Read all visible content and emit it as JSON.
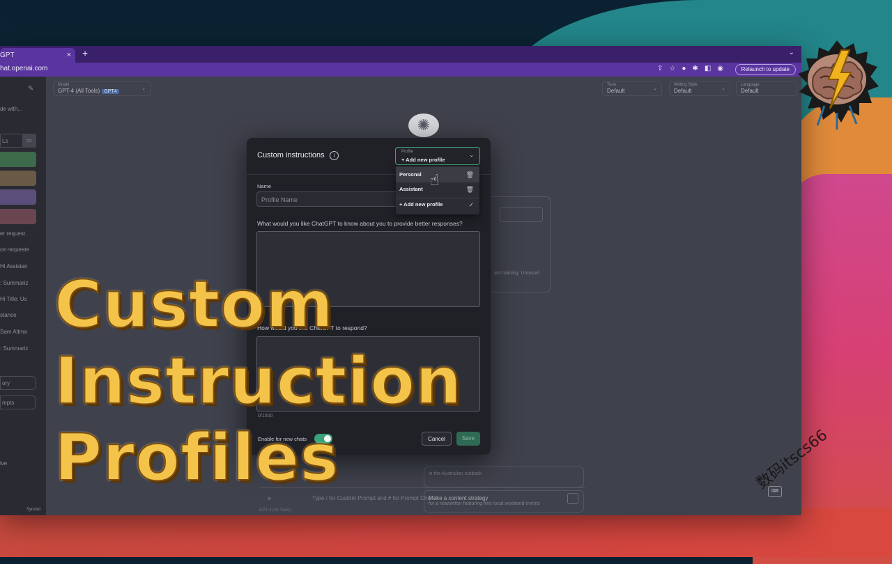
{
  "browser": {
    "tab_title": "GPT",
    "tab_close": "×",
    "new_tab": "+",
    "tab_menu": "⌄",
    "url": "hat.openai.com",
    "relaunch_label": "Relaunch to update"
  },
  "sidebar": {
    "items": [
      "de with...",
      "er request.",
      "ce requeste",
      "Hi Assistan",
      ": Summariz",
      "Hi Title: Us",
      "stance",
      "Sam Altma",
      ": Summariz",
      "ive",
      "Synced"
    ],
    "buttons": [
      "ory",
      "mpts"
    ],
    "search_placeholder": "Ls",
    "block_colors": [
      "#3c6a4a",
      "#6a5a45",
      "#5c4e7a",
      "#6a4650"
    ]
  },
  "top_selectors": {
    "model": {
      "label": "Model",
      "value": "GPT-4 (All Tools)",
      "badge": "GPT4"
    },
    "tone": {
      "label": "Tone",
      "value": "Default"
    },
    "writing_style": {
      "label": "Writing Style",
      "value": "Default"
    },
    "language": {
      "label": "Language",
      "value": "Default"
    }
  },
  "background": {
    "card_text_1": "ant training. Unusual",
    "suggestion_1": "in the Australian outback",
    "suggestion_2_title": "Make a content strategy",
    "suggestion_2_sub": "for a newsletter featuring free local weekend events",
    "chat_placeholder": "Type / for Custom Prompt and # for Prompt Chains",
    "footer": "GPT-4 (All Tools)"
  },
  "modal": {
    "title": "Custom instructions",
    "profile_label": "Profile",
    "profile_value": "+ Add new profile",
    "dropdown": [
      {
        "label": "Personal",
        "icon": "trash-icon"
      },
      {
        "label": "Assistant",
        "icon": "trash-icon"
      },
      {
        "label": "+ Add new profile",
        "icon": "check-icon"
      }
    ],
    "name_label": "Name",
    "name_placeholder": "Profile Name",
    "question_1": "What would you like ChatGPT to know about you to provide better responses?",
    "question_2": "How would you like ChatGPT to respond?",
    "counter": "0/1500",
    "toggle_label": "Enable for new chats",
    "toggle_on": true,
    "cancel_label": "Cancel",
    "save_label": "Save"
  },
  "overlay": {
    "title_lines": [
      "Custom",
      "Instruction",
      "Profiles"
    ],
    "watermark": "数码itscs66",
    "colors": {
      "title_fill": "#f4c44a",
      "title_outline": "#7a4e10"
    }
  }
}
